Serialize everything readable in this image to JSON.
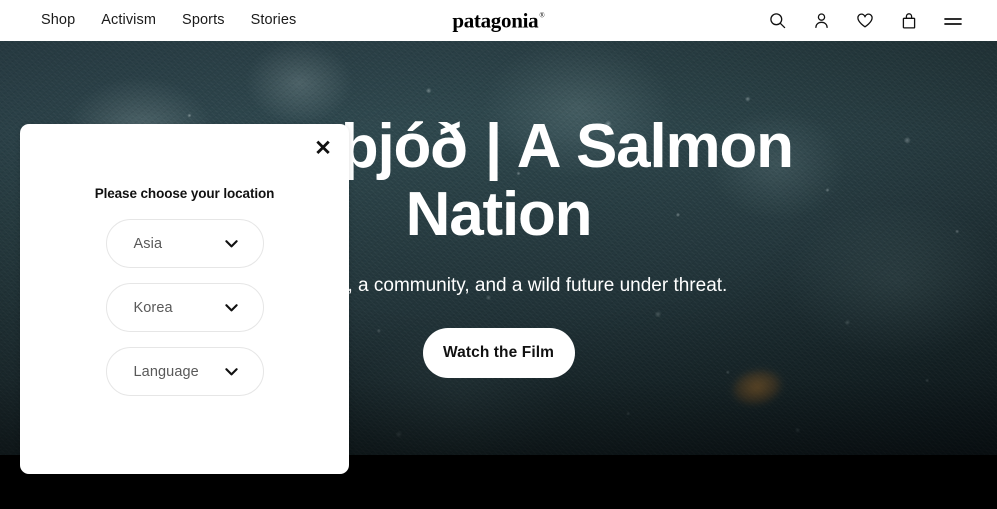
{
  "header": {
    "nav_items": [
      {
        "label": "Shop",
        "name": "nav-link-shop"
      },
      {
        "label": "Activism",
        "name": "nav-link-activism"
      },
      {
        "label": "Sports",
        "name": "nav-link-sports"
      },
      {
        "label": "Stories",
        "name": "nav-link-stories"
      }
    ],
    "brand": {
      "wordmark": "patagonia",
      "trademark": "®"
    },
    "utility_icons": [
      {
        "name": "search-icon",
        "label": "Search"
      },
      {
        "name": "account-icon",
        "label": "Account"
      },
      {
        "name": "heart-icon",
        "label": "Wishlist"
      },
      {
        "name": "bag-icon",
        "label": "Cart"
      },
      {
        "name": "hamburger-menu-icon",
        "label": "Menu"
      }
    ]
  },
  "hero": {
    "title": "Laxaþjóð | A Salmon Nation",
    "subtitle": "A country, a community, and a wild future under threat.",
    "cta_label": "Watch the Film"
  },
  "location_modal": {
    "close_label": "✕",
    "heading": "Please choose your location",
    "selects": [
      {
        "name": "region-select",
        "value": "Asia",
        "chevron": "chevron-down-icon"
      },
      {
        "name": "country-select",
        "value": "Korea",
        "chevron": "chevron-down-icon"
      },
      {
        "name": "language-select",
        "value": "Language",
        "chevron": "chevron-down-icon"
      }
    ]
  },
  "colors": {
    "header_bg": "#ffffff",
    "text_primary": "#1a1a1a",
    "hero_water": "#2b4246",
    "hero_text": "#ffffff",
    "cta_bg": "#ffffff",
    "cta_text": "#111111",
    "modal_bg": "#ffffff",
    "select_border": "#e6e6e6",
    "select_text": "#595959",
    "footer_bg": "#000000"
  }
}
